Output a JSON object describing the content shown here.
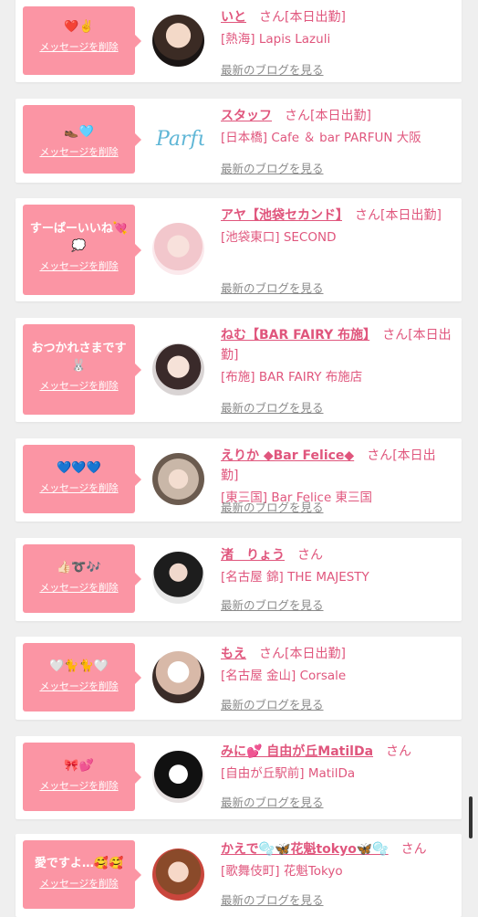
{
  "delete_label": "メッセージを削除",
  "blog_label": "最新のブログを見る",
  "items": [
    {
      "message": "❤️✌️",
      "name": "いと",
      "suffix": "さん",
      "status": "[本日出勤]",
      "shop": "[熱海] Lapis Lazuli"
    },
    {
      "message": "👞🩵",
      "name": "スタッフ",
      "suffix": "さん",
      "status": "[本日出勤]",
      "shop": "[日本橋] Cafe ＆ bar PARFUN 大阪"
    },
    {
      "message": "すーぱーいいね💘💭",
      "name": "アヤ【池袋セカンド】",
      "suffix": "さん",
      "status": "[本日出勤]",
      "shop": "[池袋東口] SECOND"
    },
    {
      "message": "おつかれさまです🐰",
      "name": "ねむ【BAR FAIRY 布施】",
      "suffix": "さん",
      "status": "[本日出勤]",
      "shop": "[布施] BAR FAIRY 布施店"
    },
    {
      "message": "💙💙💙",
      "name": "えりか ◆Bar Felice◆",
      "suffix": "さん",
      "status": "[本日出勤]",
      "shop": "[東三国] Bar Felice 東三国"
    },
    {
      "message": "👍🏻➰🎶",
      "name": "渚　りょう",
      "suffix": "さん",
      "status": "",
      "shop": "[名古屋 錦] THE MAJESTY"
    },
    {
      "message": "🤍🐈🐈🤍",
      "name": "もえ",
      "suffix": "さん",
      "status": "[本日出勤]",
      "shop": "[名古屋 金山] Corsale"
    },
    {
      "message": "🎀💕",
      "name": "みに💕 自由が丘MatilDa",
      "suffix": "さん",
      "status": "",
      "shop": "[自由が丘駅前] MatilDa"
    },
    {
      "message": "愛ですよ…🥰🥰",
      "name": "かえで🫧🦋花魁tokyo🦋🫧",
      "suffix": "さん",
      "status": "",
      "shop": "[歌舞伎町] 花魁Tokyo"
    }
  ],
  "colors": {
    "accent": "#e0567d",
    "message_bg": "#fb95a4",
    "page_bg": "#efefef"
  }
}
